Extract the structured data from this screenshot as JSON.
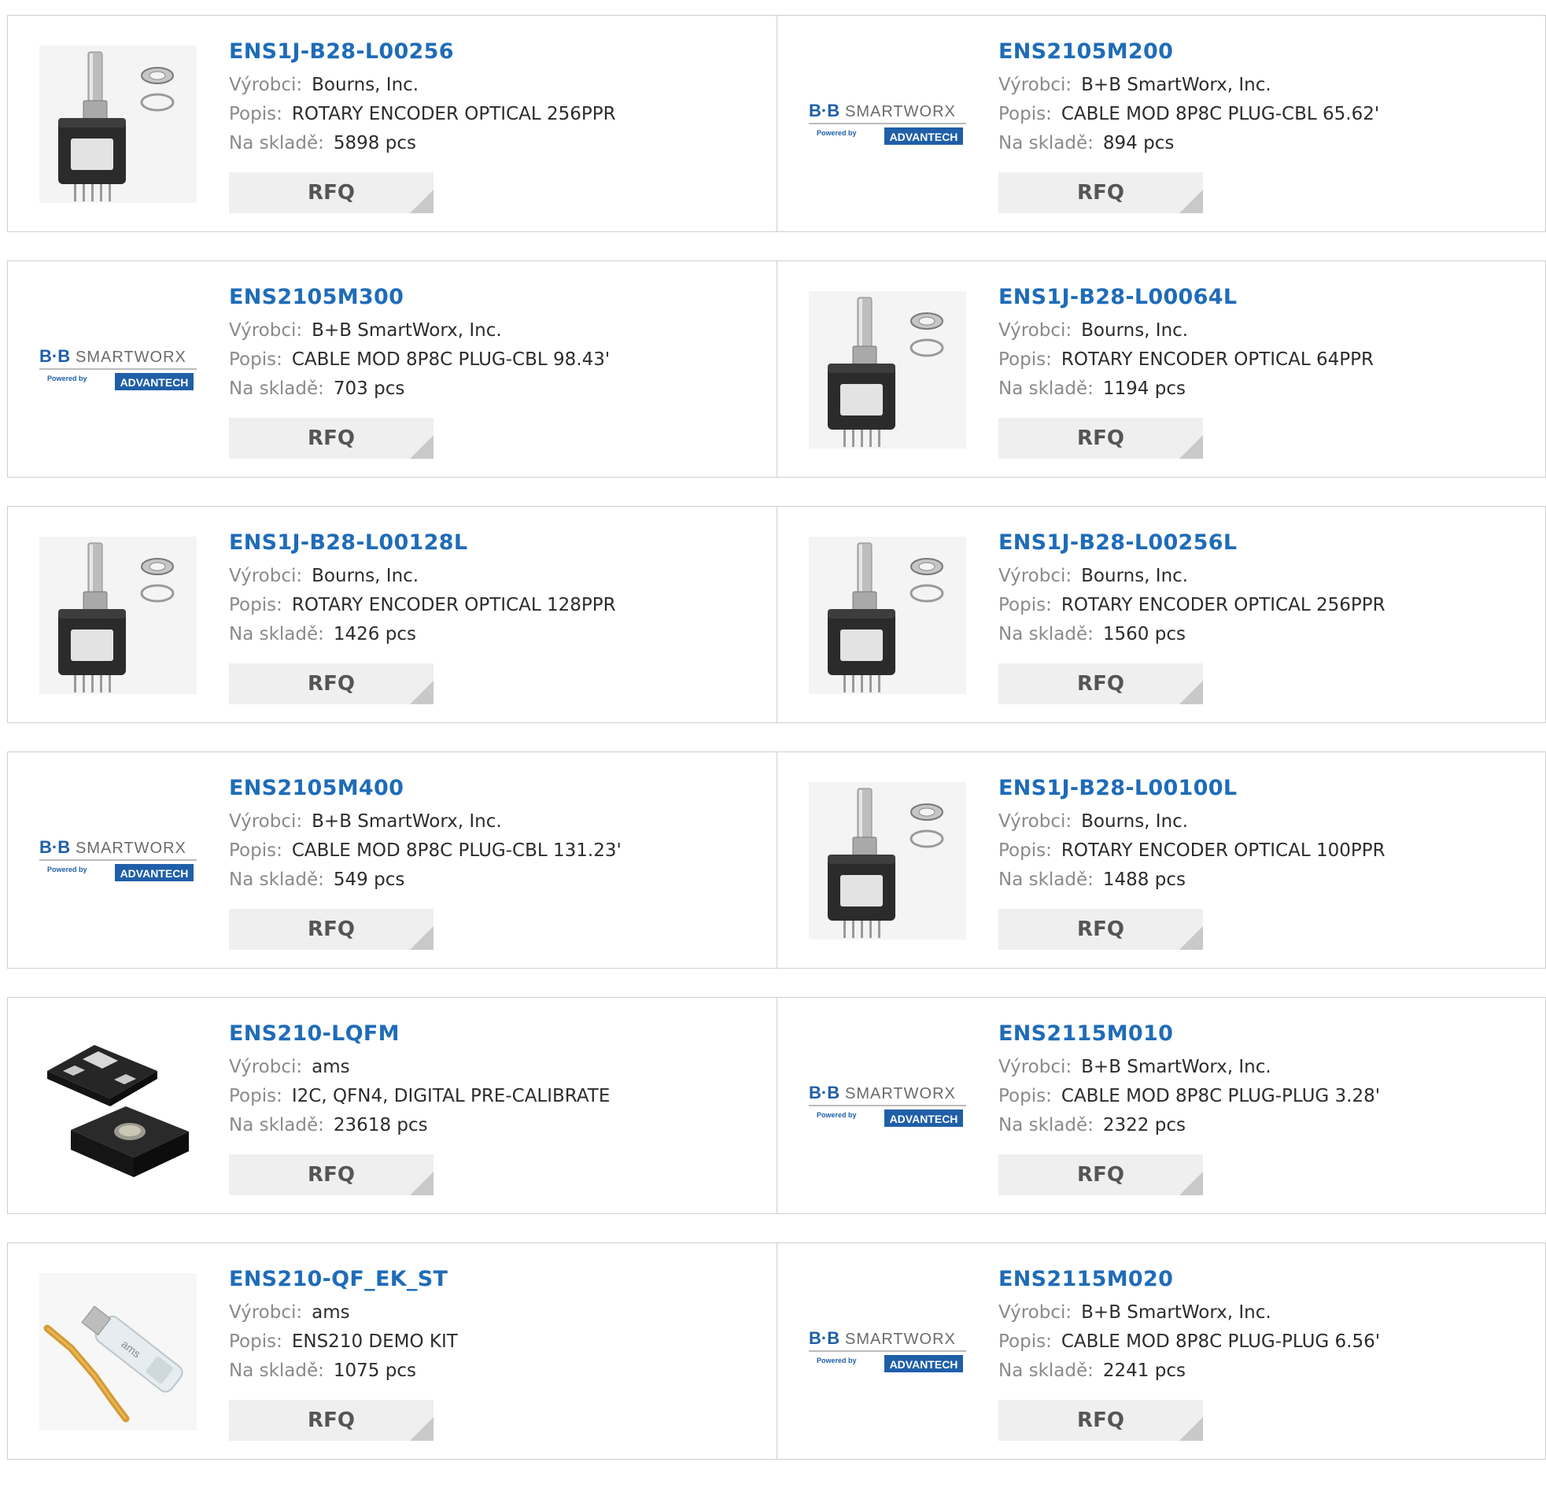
{
  "labels": {
    "manufacturer": "Výrobci:",
    "description": "Popis:",
    "stock": "Na skladě:",
    "rfq": "RFQ"
  },
  "products": [
    {
      "part": "ENS1J-B28-L00256",
      "manufacturer": "Bourns, Inc.",
      "description": "ROTARY ENCODER OPTICAL 256PPR",
      "stock": "5898 pcs",
      "image": "rotary-encoder"
    },
    {
      "part": "ENS2105M200",
      "manufacturer": "B+B SmartWorx, Inc.",
      "description": "CABLE MOD 8P8C PLUG-CBL 65.62'",
      "stock": "894 pcs",
      "image": "bb-smartworx-logo"
    },
    {
      "part": "ENS2105M300",
      "manufacturer": "B+B SmartWorx, Inc.",
      "description": "CABLE MOD 8P8C PLUG-CBL 98.43'",
      "stock": "703 pcs",
      "image": "bb-smartworx-logo"
    },
    {
      "part": "ENS1J-B28-L00064L",
      "manufacturer": "Bourns, Inc.",
      "description": "ROTARY ENCODER OPTICAL 64PPR",
      "stock": "1194 pcs",
      "image": "rotary-encoder"
    },
    {
      "part": "ENS1J-B28-L00128L",
      "manufacturer": "Bourns, Inc.",
      "description": "ROTARY ENCODER OPTICAL 128PPR",
      "stock": "1426 pcs",
      "image": "rotary-encoder"
    },
    {
      "part": "ENS1J-B28-L00256L",
      "manufacturer": "Bourns, Inc.",
      "description": "ROTARY ENCODER OPTICAL 256PPR",
      "stock": "1560 pcs",
      "image": "rotary-encoder"
    },
    {
      "part": "ENS2105M400",
      "manufacturer": "B+B SmartWorx, Inc.",
      "description": "CABLE MOD 8P8C PLUG-CBL 131.23'",
      "stock": "549 pcs",
      "image": "bb-smartworx-logo"
    },
    {
      "part": "ENS1J-B28-L00100L",
      "manufacturer": "Bourns, Inc.",
      "description": "ROTARY ENCODER OPTICAL 100PPR",
      "stock": "1488 pcs",
      "image": "rotary-encoder"
    },
    {
      "part": "ENS210-LQFM",
      "manufacturer": "ams",
      "description": "I2C, QFN4, DIGITAL PRE-CALIBRATE",
      "stock": "23618 pcs",
      "image": "sensor-chip"
    },
    {
      "part": "ENS2115M010",
      "manufacturer": "B+B SmartWorx, Inc.",
      "description": "CABLE MOD 8P8C PLUG-PLUG 3.28'",
      "stock": "2322 pcs",
      "image": "bb-smartworx-logo"
    },
    {
      "part": "ENS210-QF_EK_ST",
      "manufacturer": "ams",
      "description": "ENS210 DEMO KIT",
      "stock": "1075 pcs",
      "image": "usb-demo-kit"
    },
    {
      "part": "ENS2115M020",
      "manufacturer": "B+B SmartWorx, Inc.",
      "description": "CABLE MOD 8P8C PLUG-PLUG 6.56'",
      "stock": "2241 pcs",
      "image": "bb-smartworx-logo"
    }
  ],
  "logo": {
    "brand": "B+B SMARTWORX",
    "tagline": "Powered by",
    "partner": "ADVANTECH"
  },
  "colors": {
    "link": "#1f6cb8",
    "label": "#8a8a8a",
    "button_bg": "#efefef",
    "border": "#cfcfcf"
  }
}
